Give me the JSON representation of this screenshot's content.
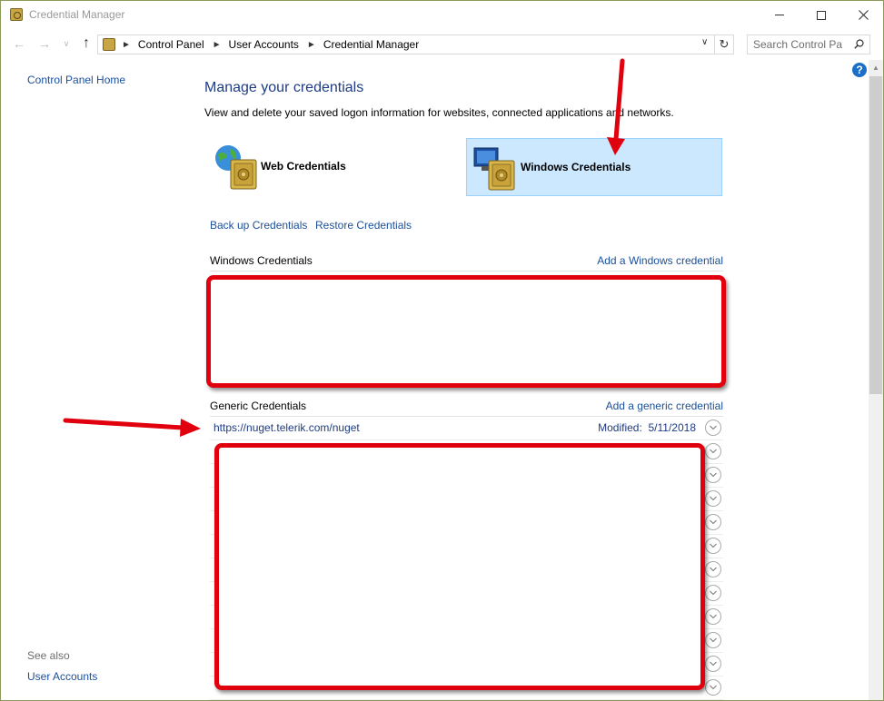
{
  "window": {
    "title": "Credential Manager",
    "controls": {
      "minimize": "minimize-icon",
      "maximize": "maximize-icon",
      "close": "close-icon"
    }
  },
  "address_bar": {
    "breadcrumbs": [
      "Control Panel",
      "User Accounts",
      "Credential Manager"
    ],
    "search_placeholder": "Search Control Pa"
  },
  "left_pane": {
    "home_link": "Control Panel Home",
    "see_also_label": "See also",
    "see_also_links": [
      "User Accounts"
    ]
  },
  "main": {
    "title": "Manage your credentials",
    "description": "View and delete your saved logon information for websites, connected applications and networks.",
    "tiles": [
      {
        "label": "Web Credentials",
        "selected": false
      },
      {
        "label": "Windows Credentials",
        "selected": true
      }
    ],
    "backup_link": "Back up Credentials",
    "restore_link": "Restore Credentials",
    "windows_section": {
      "title": "Windows Credentials",
      "action": "Add a Windows credential"
    },
    "generic_section": {
      "title": "Generic Credentials",
      "action": "Add a generic credential",
      "rows": [
        {
          "name": "https://nuget.telerik.com/nuget",
          "modified_label": "Modified:",
          "modified_date": "5/11/2018"
        }
      ],
      "hidden_row_count": 11
    }
  },
  "colors": {
    "link": "#1a4f9c",
    "heading": "#1e3c82",
    "selected_tile": "#cce8ff",
    "annotation_red": "#e0000e"
  }
}
